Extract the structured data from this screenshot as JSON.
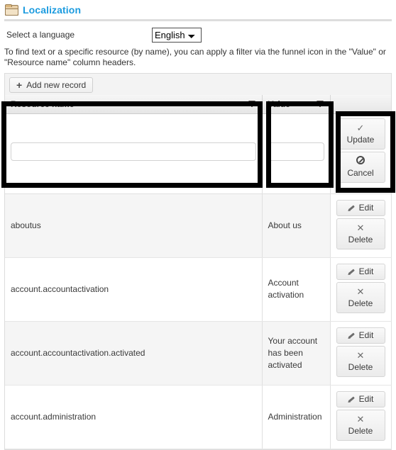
{
  "page": {
    "title": "Localization",
    "folder_icon": "folder-icon"
  },
  "language": {
    "label": "Select a language",
    "selected": "English",
    "options": [
      "English"
    ]
  },
  "help": {
    "text": "To find text or a specific resource (by name), you can apply a filter via the funnel icon in the \"Value\" or \"Resource name\" column headers."
  },
  "toolbar": {
    "add_label": "Add new record",
    "add_icon": "plus-icon"
  },
  "grid": {
    "columns": [
      {
        "label": "Resource name",
        "filter_icon": "funnel-icon"
      },
      {
        "label": "Value",
        "filter_icon": "funnel-icon"
      },
      {
        "label": ""
      }
    ],
    "edit_row": {
      "resource_value": "",
      "value_value": "",
      "update_label": "Update",
      "update_icon": "check-icon",
      "cancel_label": "Cancel",
      "cancel_icon": "no-entry-icon"
    },
    "row_actions": {
      "edit_label": "Edit",
      "edit_icon": "pencil-icon",
      "delete_label": "Delete",
      "delete_icon": "x-icon"
    },
    "rows": [
      {
        "resource": "aboutus",
        "value": "About us"
      },
      {
        "resource": "account.accountactivation",
        "value": "Account activation"
      },
      {
        "resource": "account.accountactivation.activated",
        "value": "Your account has been activated"
      },
      {
        "resource": "account.administration",
        "value": "Administration"
      }
    ]
  },
  "highlights": [
    {
      "name": "resource-name-column-highlight"
    },
    {
      "name": "value-column-highlight"
    },
    {
      "name": "row-actions-highlight"
    }
  ],
  "colors": {
    "title_blue": "#1b9bdf",
    "annotation_black": "#000000",
    "row_alt": "#f5f5f5",
    "header_gray": "#ececec"
  }
}
